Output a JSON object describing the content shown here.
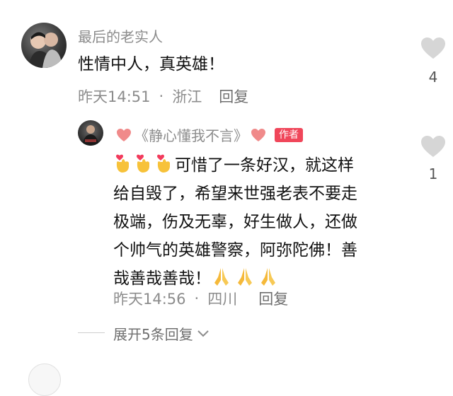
{
  "comment": {
    "username": "最后的老实人",
    "text": "性情中人，真英雄！",
    "time": "昨天14:51",
    "separator": "·",
    "location": "浙江",
    "reply_label": "回复",
    "like_count": "4"
  },
  "reply": {
    "username": "《静心懂我不言》",
    "author_badge": "作者",
    "lines": [
      "可惜了一条好汉，就这样",
      "给自毁了，希望来世强老表不要走",
      "极端，伤及无辜，好生做人，还做",
      "个帅气的英雄警察，阿弥陀佛！善",
      "哉善哉善哉！"
    ],
    "time": "昨天14:56",
    "separator": "·",
    "location": "四川",
    "reply_label": "回复",
    "like_count": "1"
  },
  "expand": {
    "label": "展开5条回复"
  },
  "colors": {
    "like_heart": "#d6d6d6",
    "author_badge": "#f0465a",
    "name_heart": "#f08a8a",
    "meta_text": "#8c8c8c"
  },
  "icons": [
    "like-heart-icon",
    "heart-emoji-icon",
    "finger-heart-emoji-icon",
    "folded-hands-emoji-icon",
    "chevron-down-icon"
  ]
}
